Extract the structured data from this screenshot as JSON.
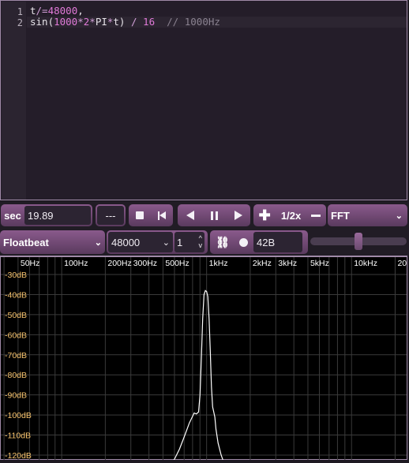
{
  "editor": {
    "line_numbers": [
      "1",
      "2"
    ],
    "line1": {
      "t": "t",
      "op": "/=",
      "num": "48000",
      "comma": ","
    },
    "line2": {
      "fn": "sin(",
      "n1": "1000",
      "op1": "*",
      "n2": "2",
      "op2": "*",
      "pi": "PI",
      "op3": "*",
      "t": "t)",
      "div": " / ",
      "n3": "16",
      "comment": "  // 1000Hz"
    }
  },
  "toolbar": {
    "time_unit": "sec",
    "time_value": "19.89",
    "counter": "---",
    "speed": "1/2x",
    "view_mode": "FFT"
  },
  "settings": {
    "mode": "Floatbeat",
    "sample_rate": "48000",
    "stereo_value": "1",
    "size": "42B",
    "volume": 0.5
  },
  "chart_data": {
    "type": "line",
    "title": "",
    "xscale": "log",
    "xlabels": [
      "50Hz",
      "100Hz",
      "200Hz",
      "300Hz",
      "500Hz",
      "1kHz",
      "2kHz",
      "3kHz",
      "5kHz",
      "10kHz",
      "20k"
    ],
    "ylabels": [
      "-30dB",
      "-40dB",
      "-50dB",
      "-60dB",
      "-70dB",
      "-80dB",
      "-90dB",
      "-100dB",
      "-110dB",
      "-120dB"
    ],
    "ylim": [
      -125,
      -25
    ],
    "series": [
      {
        "x": [
          540,
          600,
          650,
          700,
          760,
          820,
          850,
          880,
          900,
          920,
          940,
          960,
          980,
          1000,
          1020,
          1040,
          1060,
          1080,
          1100,
          1120,
          1140,
          1160,
          1200,
          1260,
          1320,
          1380
        ],
        "y": [
          -126,
          -122,
          -117,
          -111,
          -104,
          -99,
          -99.5,
          -98.5,
          -90,
          -72,
          -52,
          -40,
          -38,
          -38.5,
          -41,
          -52,
          -68,
          -86,
          -96,
          -98.5,
          -101,
          -107,
          -114,
          -120,
          -124,
          -126
        ]
      }
    ]
  }
}
